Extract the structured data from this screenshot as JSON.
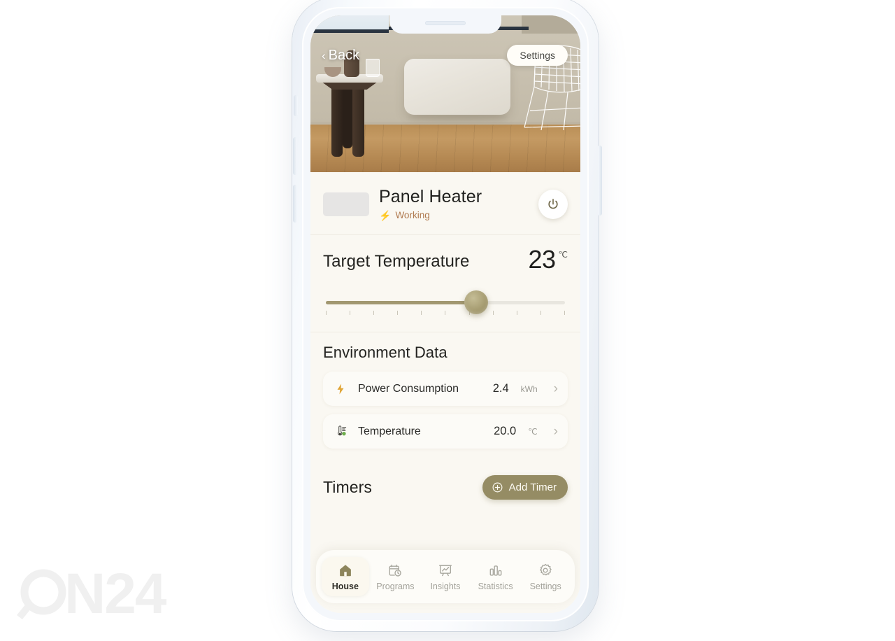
{
  "watermark": {
    "text": "ON24"
  },
  "hero": {
    "back_label": "Back",
    "back_chevron": "chevron-left-icon",
    "settings_label": "Settings",
    "scene_alt": "panel-heater-on-wall-photo"
  },
  "device": {
    "name": "Panel Heater",
    "status_label": "Working",
    "status_icon": "bolt-icon",
    "power_icon": "power-icon"
  },
  "target_temperature": {
    "label": "Target Temperature",
    "value": "23",
    "unit": "℃",
    "slider": {
      "fill_percent": 60,
      "tick_count": 11,
      "accent_color": "#a29871",
      "track_color": "#e8e6df"
    }
  },
  "environment": {
    "title": "Environment Data",
    "items": [
      {
        "icon": "bolt-icon",
        "name": "Power Consumption",
        "value": "2.4",
        "unit": "kWh",
        "chevron": "chevron-right-icon"
      },
      {
        "icon": "thermometer-icon",
        "name": "Temperature",
        "value": "20.0",
        "unit": "℃",
        "chevron": "chevron-right-icon"
      }
    ]
  },
  "timers": {
    "title": "Timers",
    "add_label": "Add Timer",
    "add_icon": "plus-circle-icon"
  },
  "tabbar": {
    "items": [
      {
        "label": "House",
        "icon": "house-icon",
        "active": true
      },
      {
        "label": "Programs",
        "icon": "calendar-clock-icon",
        "active": false
      },
      {
        "label": "Insights",
        "icon": "presentation-chart-icon",
        "active": false
      },
      {
        "label": "Statistics",
        "icon": "bar-chart-icon",
        "active": false
      },
      {
        "label": "Settings",
        "icon": "gear-icon",
        "active": false
      }
    ]
  },
  "colors": {
    "accent": "#958c64",
    "status": "#b07a4f",
    "bolt": "#e0a536",
    "thermo_dot": "#6fae4e",
    "background": "#faf8f2"
  }
}
